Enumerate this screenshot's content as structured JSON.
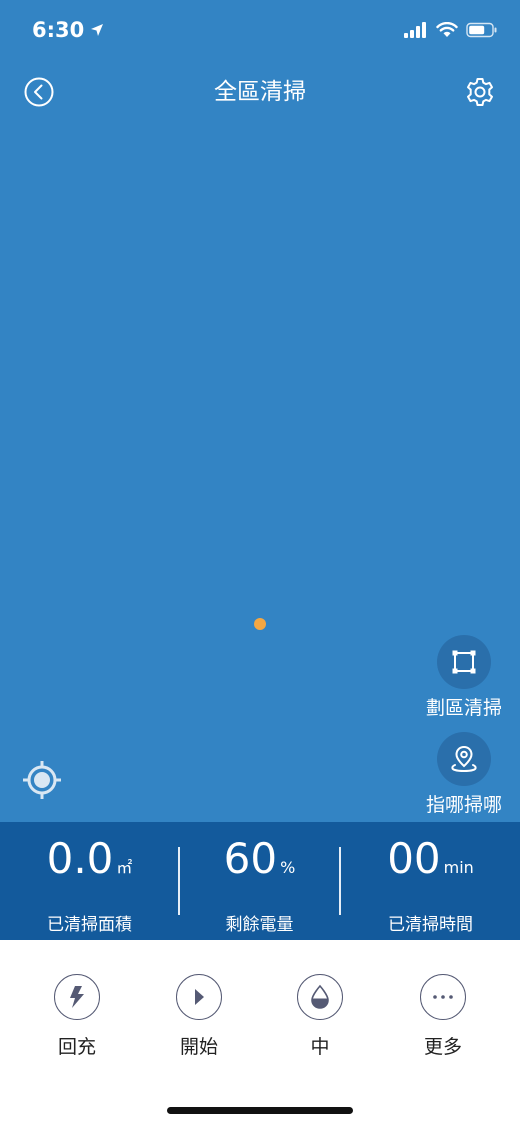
{
  "status_bar": {
    "time": "6:30"
  },
  "header": {
    "title": "全區清掃"
  },
  "side_actions": {
    "zone_clean_label": "劃區清掃",
    "spot_clean_label": "指哪掃哪"
  },
  "stats": {
    "area": {
      "value": "0.0",
      "unit": "㎡",
      "label": "已清掃面積"
    },
    "battery": {
      "value": "60",
      "unit": "%",
      "label": "剩餘電量"
    },
    "time": {
      "value": "00",
      "unit": "min",
      "label": "已清掃時間"
    }
  },
  "controls": {
    "recharge_label": "回充",
    "start_label": "開始",
    "water_label": "中",
    "more_label": "更多"
  },
  "colors": {
    "map_bg": "#3384c4",
    "stats_bg": "#135a9c",
    "robot_dot": "#f5a742",
    "icon_dark": "#555a74"
  }
}
